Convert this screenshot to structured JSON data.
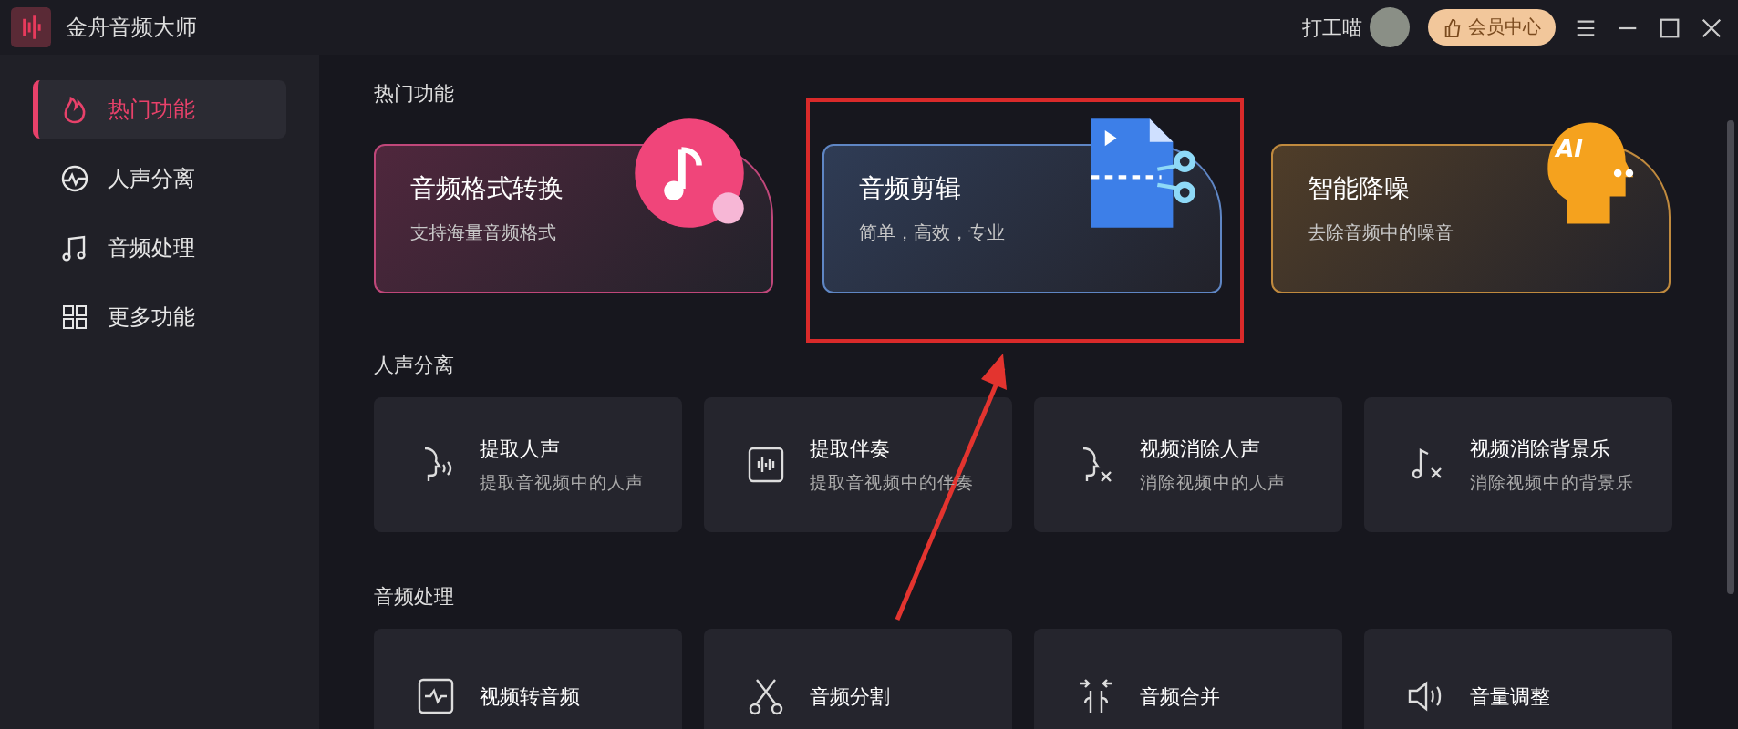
{
  "window": {
    "title": "金舟音频大师"
  },
  "header": {
    "user_name": "打工喵",
    "vip_button": "会员中心"
  },
  "sidebar": {
    "items": [
      {
        "label": "热门功能",
        "selected": true
      },
      {
        "label": "人声分离",
        "selected": false
      },
      {
        "label": "音频处理",
        "selected": false
      },
      {
        "label": "更多功能",
        "selected": false
      }
    ]
  },
  "hot": {
    "title": "热门功能",
    "cards": [
      {
        "title": "音频格式转换",
        "subtitle": "支持海量音频格式",
        "color": "#c0477a"
      },
      {
        "title": "音频剪辑",
        "subtitle": "简单，高效，专业",
        "color": "#5f86c4"
      },
      {
        "title": "智能降噪",
        "subtitle": "去除音频中的噪音",
        "color": "#c08a3e",
        "badge": "AI"
      }
    ]
  },
  "sections": [
    {
      "title": "人声分离",
      "tools": [
        {
          "title": "提取人声",
          "subtitle": "提取音视频中的人声"
        },
        {
          "title": "提取伴奏",
          "subtitle": "提取音视频中的伴奏"
        },
        {
          "title": "视频消除人声",
          "subtitle": "消除视频中的人声"
        },
        {
          "title": "视频消除背景乐",
          "subtitle": "消除视频中的背景乐"
        }
      ]
    },
    {
      "title": "音频处理",
      "tools": [
        {
          "title": "视频转音频"
        },
        {
          "title": "音频分割"
        },
        {
          "title": "音频合并"
        },
        {
          "title": "音量调整"
        }
      ]
    }
  ]
}
